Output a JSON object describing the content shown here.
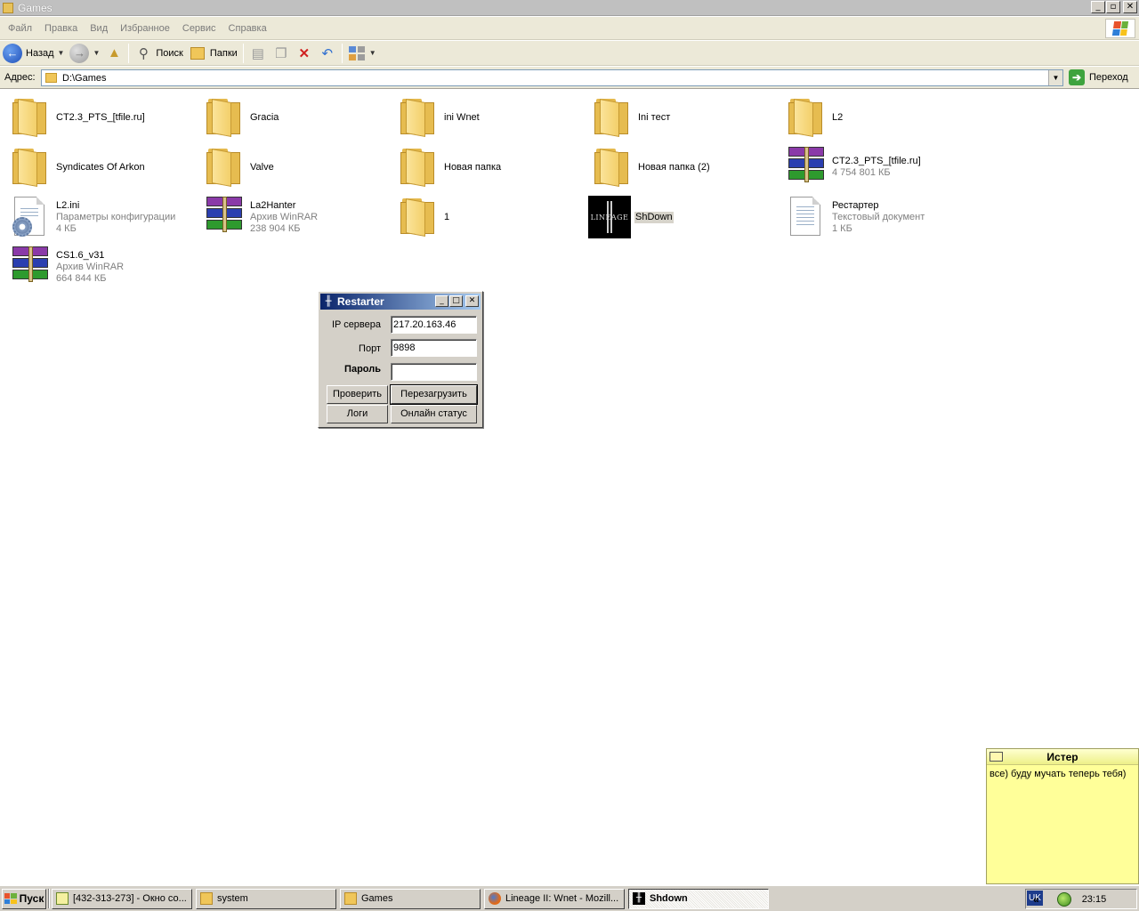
{
  "window": {
    "title": "Games",
    "buttons": {
      "minimize": "_",
      "maximize": "▫",
      "close": "✕"
    }
  },
  "menu": [
    "Файл",
    "Правка",
    "Вид",
    "Избранное",
    "Сервис",
    "Справка"
  ],
  "toolbar": {
    "back_label": "Назад",
    "search_label": "Поиск",
    "folders_label": "Папки"
  },
  "address": {
    "label": "Адрес:",
    "value": "D:\\Games",
    "go_label": "Переход"
  },
  "files": [
    {
      "name": "CT2.3_PTS_[tfile.ru]",
      "type": "folder",
      "details": []
    },
    {
      "name": "Gracia",
      "type": "folder",
      "details": []
    },
    {
      "name": "ini Wnet",
      "type": "folder",
      "details": []
    },
    {
      "name": "Ini тест",
      "type": "folder",
      "details": []
    },
    {
      "name": "L2",
      "type": "folder",
      "details": []
    },
    {
      "name": "Syndicates Of Arkon",
      "type": "folder",
      "details": []
    },
    {
      "name": "Valve",
      "type": "folder",
      "details": []
    },
    {
      "name": "Новая папка",
      "type": "folder",
      "details": []
    },
    {
      "name": "Новая папка (2)",
      "type": "folder",
      "details": []
    },
    {
      "name": "CT2.3_PTS_[tfile.ru]",
      "type": "rar",
      "details": [
        "4 754 801 КБ"
      ]
    },
    {
      "name": "L2.ini",
      "type": "ini",
      "details": [
        "Параметры конфигурации",
        "4 КБ"
      ]
    },
    {
      "name": "La2Hanter",
      "type": "rar",
      "details": [
        "Архив WinRAR",
        "238 904 КБ"
      ]
    },
    {
      "name": "1",
      "type": "folder",
      "details": []
    },
    {
      "name": "ShDown",
      "type": "lineage",
      "icon_text": "LINEAGE",
      "details": []
    },
    {
      "name": "Рестартер",
      "type": "text",
      "details": [
        "Текстовый документ",
        "1 КБ"
      ]
    },
    {
      "name": "CS1.6_v31",
      "type": "rar",
      "details": [
        "Архив WinRAR",
        "664 844 КБ"
      ]
    }
  ],
  "dialog": {
    "title": "Restarter",
    "ip_label": "IP сервера",
    "ip_value": "217.20.163.46",
    "port_label": "Порт",
    "port_value": "9898",
    "password_label": "Пароль",
    "password_value": "",
    "check_label": "Проверить",
    "restart_label": "Перезагрузить",
    "logs_label": "Логи",
    "status_label": "Онлайн статус"
  },
  "note": {
    "title": "Истер",
    "text": "все) буду мучать теперь тебя)"
  },
  "taskbar": {
    "start_label": "Пуск",
    "tasks": [
      {
        "label": "[432-313-273] - Окно со...",
        "icon": "qip-icon",
        "active": false
      },
      {
        "label": "system",
        "icon": "folder-icon",
        "active": false
      },
      {
        "label": "Games",
        "icon": "folder-icon",
        "active": false
      },
      {
        "label": "Lineage II: Wnet - Mozill...",
        "icon": "firefox-icon",
        "active": false
      },
      {
        "label": "Shdown",
        "icon": "lineage-icon",
        "active": true
      }
    ],
    "lang": "UK",
    "chevron": "«",
    "clock": "23:15"
  },
  "colors": {
    "titlebar_active": "#0a246a",
    "note_bg": "#ffff99",
    "menu_bg": "#ece9d8"
  }
}
